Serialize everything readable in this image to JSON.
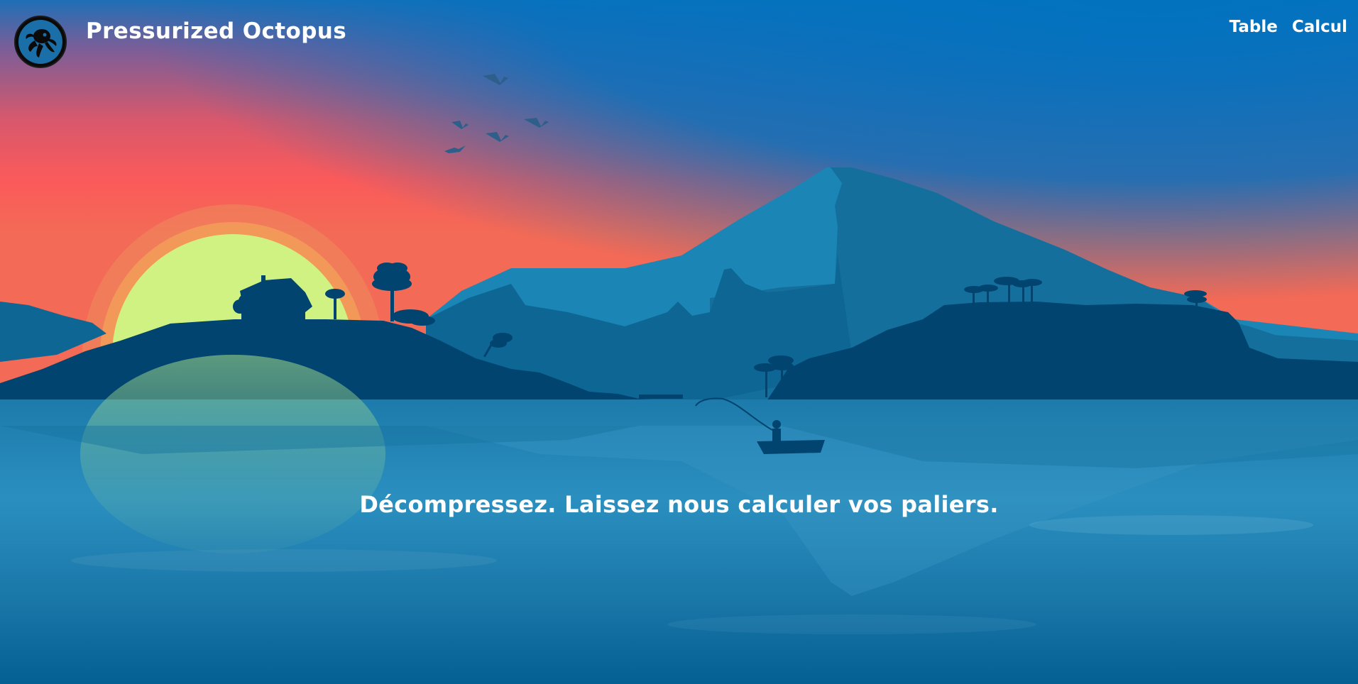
{
  "header": {
    "brand": "Pressurized Octopus",
    "logo_icon": "octopus-icon",
    "nav": [
      {
        "label": "Table"
      },
      {
        "label": "Calcul"
      }
    ]
  },
  "hero": {
    "tagline": "Décompressez. Laissez nous calculer vos paliers."
  },
  "colors": {
    "sky_top": "#0272bf",
    "sky_horizon": "#f9585c",
    "sun": "#cff282",
    "mountain_light": "#1b86b6",
    "hill_dark": "#00446f",
    "water": "#1f84b4"
  }
}
